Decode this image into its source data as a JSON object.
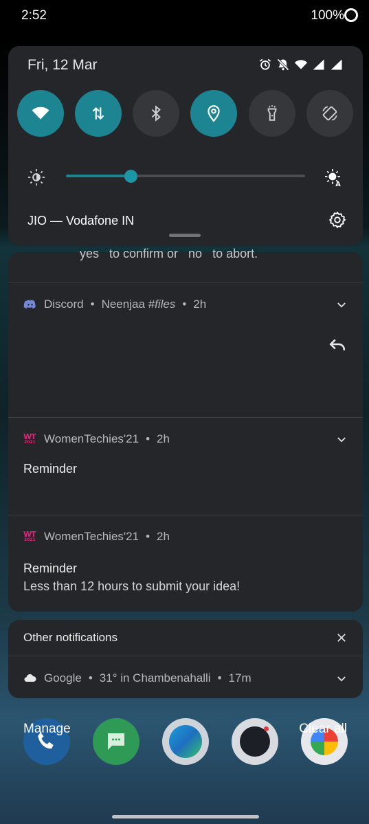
{
  "status_bar": {
    "time": "2:52",
    "battery": "100%"
  },
  "quick_settings": {
    "date": "Fri, 12 Mar",
    "tiles": [
      {
        "name": "wifi",
        "icon": "wifi-icon",
        "active": true
      },
      {
        "name": "mobile-data",
        "icon": "mobile-data-icon",
        "active": true
      },
      {
        "name": "bluetooth",
        "icon": "bluetooth-icon",
        "active": false
      },
      {
        "name": "location",
        "icon": "location-icon",
        "active": true
      },
      {
        "name": "flashlight",
        "icon": "flashlight-icon",
        "active": false
      },
      {
        "name": "auto-rotate",
        "icon": "auto-rotate-icon",
        "active": false
      }
    ],
    "brightness_level": 0.27,
    "carrier": "JIO — Vodafone IN"
  },
  "notifications": {
    "partial_text": "yes   to confirm or   no   to abort.",
    "discord": {
      "app": "Discord",
      "sep1": "•",
      "sender": "Neenjaa",
      "channel": "#files",
      "sep2": "•",
      "time": "2h"
    },
    "wt1": {
      "app": "WomenTechies'21",
      "sep": "•",
      "time": "2h",
      "title": "Reminder"
    },
    "wt2": {
      "app": "WomenTechies'21",
      "sep": "•",
      "time": "2h",
      "title": "Reminder",
      "body": "Less than 12 hours to submit your idea!"
    },
    "wt_logo": {
      "letters": "WT",
      "year": "2021"
    }
  },
  "other_notifications": {
    "title": "Other notifications",
    "google": {
      "app": "Google",
      "sep1": "•",
      "text": "31° in Chambenahalli",
      "sep2": "•",
      "time": "17m"
    }
  },
  "footer": {
    "manage": "Manage",
    "clear_all": "Clear all"
  },
  "colors": {
    "accent": "#1d8592",
    "panel": "#242629",
    "tile_off": "#35373a",
    "wt_pink": "#e2227a",
    "discord_blue": "#7289da"
  }
}
